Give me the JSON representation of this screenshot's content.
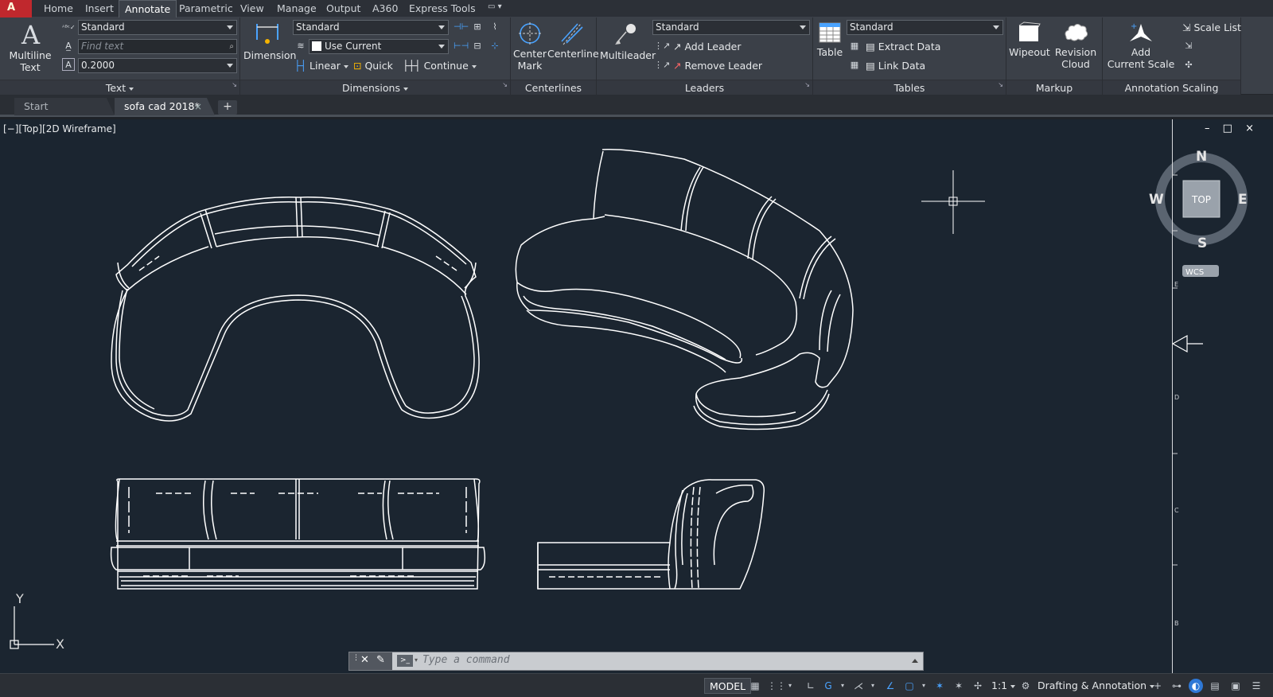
{
  "menubar": {
    "app_letter": "A",
    "tabs": [
      {
        "label": "Home"
      },
      {
        "label": "Insert"
      },
      {
        "label": "Annotate"
      },
      {
        "label": "Parametric"
      },
      {
        "label": "View"
      },
      {
        "label": "Manage"
      },
      {
        "label": "Output"
      },
      {
        "label": "A360"
      },
      {
        "label": "Express Tools"
      }
    ],
    "active_tab": "Annotate"
  },
  "ribbon": {
    "text": {
      "title": "Text",
      "multiline_label": "Multiline\nText",
      "style_combo": "Standard",
      "find_placeholder": "Find text",
      "height_combo": "0.2000"
    },
    "dimensions": {
      "title": "Dimensions",
      "dimension_label": "Dimension",
      "style_combo": "Standard",
      "layer_combo": "Use Current",
      "linear_label": "Linear",
      "quick_label": "Quick",
      "continue_label": "Continue"
    },
    "centerlines": {
      "title": "Centerlines",
      "center_mark_label": "Center\nMark",
      "centerline_label": "Centerline"
    },
    "leaders": {
      "title": "Leaders",
      "multileader_label": "Multileader",
      "style_combo": "Standard",
      "add_leader_label": "Add Leader",
      "remove_leader_label": "Remove Leader"
    },
    "tables": {
      "title": "Tables",
      "table_label": "Table",
      "style_combo": "Standard",
      "extract_data_label": "Extract Data",
      "link_data_label": "Link Data"
    },
    "markup": {
      "title": "Markup",
      "wipeout_label": "Wipeout",
      "revision_cloud_label": "Revision\nCloud"
    },
    "annotation_scaling": {
      "title": "Annotation Scaling",
      "add_current_scale_label": "Add\nCurrent Scale",
      "scale_list_label": "Scale List"
    }
  },
  "file_tabs": [
    {
      "label": "Start",
      "active": false
    },
    {
      "label": "sofa cad 2018*",
      "active": true
    }
  ],
  "viewport": {
    "label": "[−][Top][2D Wireframe]",
    "window_controls": "– □ ×",
    "background_color": "#1b2530",
    "line_color": "#ffffff",
    "viewcube": {
      "face": "TOP",
      "north": "N",
      "south": "S",
      "east": "E",
      "west": "W",
      "wcs": "WCS"
    },
    "ucs": {
      "x": "X",
      "y": "Y"
    },
    "ruler_marks": [
      "E",
      "D",
      "C",
      "B"
    ]
  },
  "command_line": {
    "placeholder": "Type a command"
  },
  "status_bar": {
    "model_label": "MODEL",
    "scale_label": "1:1",
    "workspace_label": "Drafting & Annotation"
  }
}
